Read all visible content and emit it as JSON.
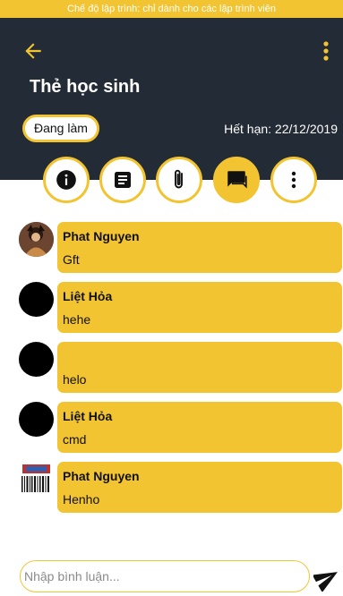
{
  "dev_banner": "Chế độ lập trình: chỉ dành cho các lập trình viên",
  "header": {
    "title": "Thẻ học sinh",
    "status_label": "Đang làm",
    "expiry": "Hết hạn: 22/12/2019"
  },
  "tabs": [
    {
      "icon": "info-icon",
      "active": false
    },
    {
      "icon": "description-icon",
      "active": false
    },
    {
      "icon": "attachment-icon",
      "active": false
    },
    {
      "icon": "comments-icon",
      "active": true
    },
    {
      "icon": "more-vertical-icon",
      "active": false
    }
  ],
  "comments": [
    {
      "author": "Phat Nguyen",
      "text": "Gft"
    },
    {
      "author": "Liệt Hỏa",
      "text": "hehe"
    },
    {
      "author": "",
      "text": "helo"
    },
    {
      "author": "Liệt Hỏa",
      "text": "cmd"
    },
    {
      "author": "Phat Nguyen",
      "text": "Henho"
    }
  ],
  "comment_input": {
    "placeholder": "Nhập bình luận..."
  },
  "colors": {
    "accent": "#f3c431",
    "header_bg": "#232b36",
    "background": "#ffffff"
  }
}
